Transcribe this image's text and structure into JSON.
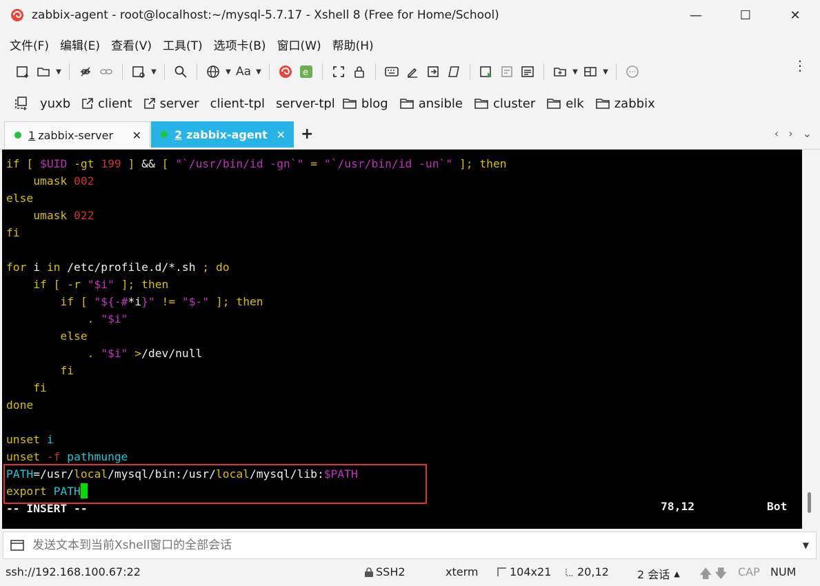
{
  "window": {
    "title": "zabbix-agent - root@localhost:~/mysql-5.7.17 - Xshell 8 (Free for Home/School)",
    "minimize": "—",
    "maximize": "☐",
    "close": "✕"
  },
  "menu": [
    "文件(F)",
    "编辑(E)",
    "查看(V)",
    "工具(T)",
    "选项卡(B)",
    "窗口(W)",
    "帮助(H)"
  ],
  "toolbar": {
    "font_label": "Aa"
  },
  "links": [
    {
      "label": "yuxb",
      "icon": "new-window-icon"
    },
    {
      "label": "client",
      "icon": "external-link-icon"
    },
    {
      "label": "server",
      "icon": "external-link-icon"
    },
    {
      "label": "client-tpl",
      "icon": ""
    },
    {
      "label": "server-tpl",
      "icon": ""
    },
    {
      "label": "blog",
      "icon": "folder-icon"
    },
    {
      "label": "ansible",
      "icon": "folder-icon"
    },
    {
      "label": "cluster",
      "icon": "folder-icon"
    },
    {
      "label": "elk",
      "icon": "folder-icon"
    },
    {
      "label": "zabbix",
      "icon": "folder-icon"
    }
  ],
  "tabs": [
    {
      "index": "1",
      "label": "zabbix-server",
      "active": false
    },
    {
      "index": "2",
      "label": "zabbix-agent",
      "active": true
    }
  ],
  "tab_add": "+",
  "tab_nav": {
    "prev": "‹",
    "next": "›",
    "menu": "⌄"
  },
  "terminal": {
    "lines": [
      "if [ $UID -gt 199 ] && [ \"`/usr/bin/id -gn`\" = \"`/usr/bin/id -un`\" ]; then",
      "    umask 002",
      "else",
      "    umask 022",
      "fi",
      "",
      "for i in /etc/profile.d/*.sh ; do",
      "    if [ -r \"$i\" ]; then",
      "        if [ \"${-#*i}\" != \"$-\" ]; then",
      "            . \"$i\"",
      "        else",
      "            . \"$i\" >/dev/null",
      "        fi",
      "    fi",
      "done",
      "",
      "unset i",
      "unset -f pathmunge",
      "PATH=/usr/local/mysql/bin:/usr/local/mysql/lib:$PATH",
      "export PATH"
    ],
    "mode": "-- INSERT --",
    "position": "78,12",
    "scroll": "Bot"
  },
  "send_bar": {
    "placeholder": "发送文本到当前Xshell窗口的全部会话"
  },
  "status": {
    "address": "ssh://192.168.100.67:22",
    "protocol": "SSH2",
    "term": "xterm",
    "size": "104x21",
    "cursor": "20,12",
    "sessions": "2 会话",
    "cap": "CAP",
    "num": "NUM"
  },
  "colors": {
    "tab_active": "#26b4e8",
    "terminal_bg": "#000000",
    "highlight_box": "#e03030",
    "cursor": "#00e000"
  }
}
